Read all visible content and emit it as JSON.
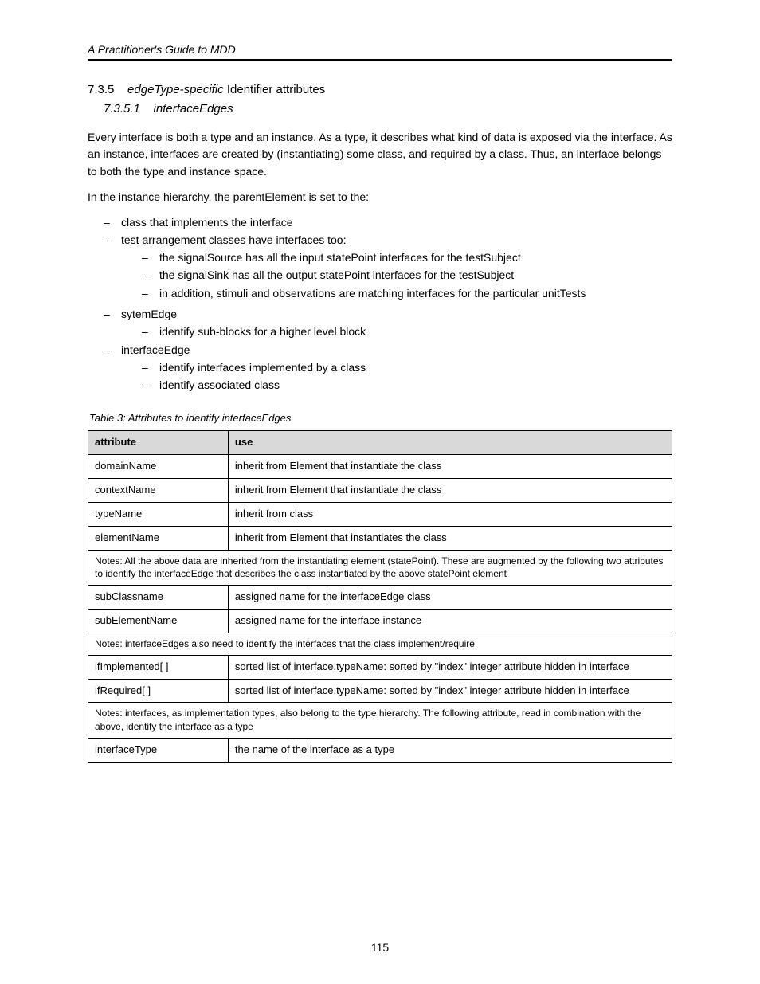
{
  "header": "A Practitioner's Guide to MDD",
  "section_number": "7.3.5",
  "section_title_em": "edgeType-specific",
  "section_title_rest": " Identifier attributes",
  "subsection_number": "7.3.5.1",
  "subsection_title": "interfaceEdges",
  "para1": "Every interface is both a type and an instance. As a type, it describes what kind of data is exposed via the interface. As an instance, interfaces are created by (instantiating) some class, and required by a class. Thus, an interface belongs to both the type and instance space.",
  "para2": "In the instance hierarchy, the parentElement is set to the:",
  "bullets1": [
    "class that implements the interface",
    {
      "text": "test arrangement classes have interfaces too:",
      "children": [
        "the signalSource has all the input statePoint interfaces for the testSubject",
        "the signalSink has all the output statePoint interfaces for the testSubject",
        "in addition, stimuli and observations are matching interfaces for the particular unitTests"
      ]
    }
  ],
  "bullets2": [
    {
      "text": "sytemEdge",
      "children": [
        "identify sub-blocks for a higher level block"
      ]
    },
    {
      "text": "interfaceEdge",
      "children": [
        "identify interfaces implemented by a class",
        "identify associated class"
      ]
    }
  ],
  "table_caption": "Table 3: Attributes to identify interfaceEdges",
  "table": {
    "headers": [
      "attribute",
      "use"
    ],
    "rows": [
      {
        "c0": "domainName",
        "c1": "inherit from Element that instantiate the class"
      },
      {
        "c0": "contextName",
        "c1": "inherit from Element that instantiate the class"
      },
      {
        "c0": "typeName",
        "c1": "inherit from class"
      },
      {
        "c0": "elementName",
        "c1": "inherit from Element that instantiates the class"
      },
      {
        "span": "Notes: All the above data are inherited from the instantiating element (statePoint). These are augmented by the following two attributes to identify the interfaceEdge that describes the class instantiated by the above statePoint element"
      },
      {
        "c0": "subClassname",
        "c1": "assigned name for the interfaceEdge class"
      },
      {
        "c0": "subElementName",
        "c1": "assigned name for the interface instance"
      },
      {
        "span": "Notes: interfaceEdges also need to identify the interfaces that the class implement/require"
      },
      {
        "c0": "ifImplemented[ ]",
        "c1": "sorted list of interface.typeName: sorted by \"index\" integer attribute hidden in interface"
      },
      {
        "c0": "ifRequired[ ]",
        "c1": "sorted list of interface.typeName: sorted by \"index\" integer attribute hidden in interface"
      },
      {
        "span": "Notes: interfaces, as implementation types, also belong to the type hierarchy. The following attribute, read in combination with the above, identify the interface as a type"
      },
      {
        "c0": "interfaceType",
        "c1": "the name of the interface as a type"
      }
    ]
  },
  "page_number": "115"
}
